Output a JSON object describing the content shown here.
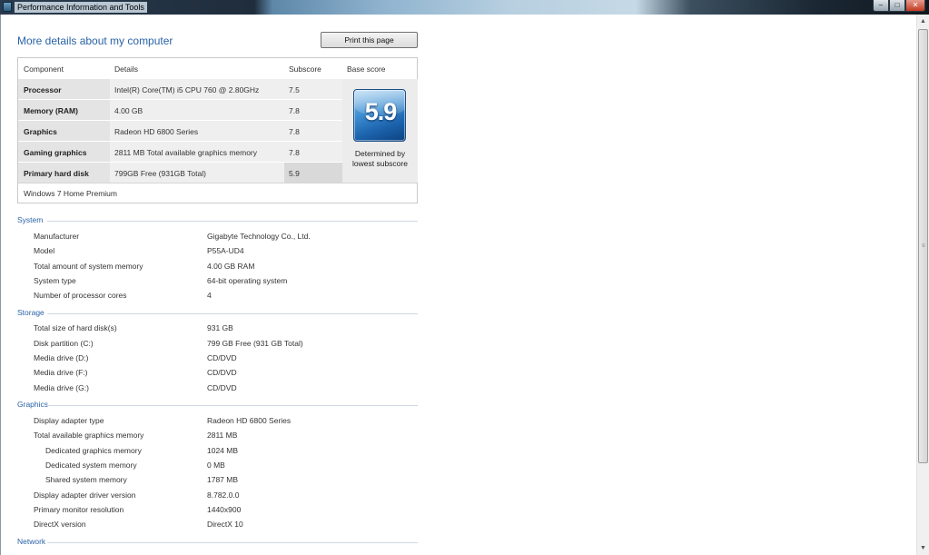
{
  "window": {
    "title": "Performance Information and Tools",
    "buttons": {
      "minimize": "–",
      "maximize": "□",
      "close": "✕"
    }
  },
  "page": {
    "title": "More details about my computer",
    "print_label": "Print this page"
  },
  "score_table": {
    "headers": [
      "Component",
      "Details",
      "Subscore",
      "Base score"
    ],
    "rows": [
      {
        "component": "Processor",
        "details": "Intel(R) Core(TM) i5 CPU 760 @ 2.80GHz",
        "subscore": "7.5"
      },
      {
        "component": "Memory (RAM)",
        "details": "4.00 GB",
        "subscore": "7.8"
      },
      {
        "component": "Graphics",
        "details": "Radeon HD 6800 Series",
        "subscore": "7.8"
      },
      {
        "component": "Gaming graphics",
        "details": "2811 MB Total available graphics memory",
        "subscore": "7.8"
      },
      {
        "component": "Primary hard disk",
        "details": "799GB Free (931GB Total)",
        "subscore": "5.9"
      }
    ],
    "base_score": "5.9",
    "base_caption_1": "Determined by",
    "base_caption_2": "lowest subscore",
    "edition": "Windows 7 Home Premium"
  },
  "sections": {
    "system": {
      "title": "System",
      "items": [
        {
          "k": "Manufacturer",
          "v": "Gigabyte Technology Co., Ltd."
        },
        {
          "k": "Model",
          "v": "P55A-UD4"
        },
        {
          "k": "Total amount of system memory",
          "v": "4.00 GB RAM"
        },
        {
          "k": "System type",
          "v": "64-bit operating system"
        },
        {
          "k": "Number of processor cores",
          "v": "4"
        }
      ]
    },
    "storage": {
      "title": "Storage",
      "items": [
        {
          "k": "Total size of hard disk(s)",
          "v": "931 GB"
        },
        {
          "k": "Disk partition (C:)",
          "v": "799 GB Free (931 GB Total)"
        },
        {
          "k": "Media drive (D:)",
          "v": "CD/DVD"
        },
        {
          "k": "Media drive (F:)",
          "v": "CD/DVD"
        },
        {
          "k": "Media drive (G:)",
          "v": "CD/DVD"
        }
      ]
    },
    "graphics": {
      "title": "Graphics",
      "items": [
        {
          "k": "Display adapter type",
          "v": "Radeon HD 6800 Series"
        },
        {
          "k": "Total available graphics memory",
          "v": "2811 MB"
        },
        {
          "k": "Dedicated graphics memory",
          "v": "1024 MB"
        },
        {
          "k": "Dedicated system memory",
          "v": "0 MB"
        },
        {
          "k": "Shared system memory",
          "v": "1787 MB"
        },
        {
          "k": "Display adapter driver version",
          "v": "8.782.0.0"
        },
        {
          "k": "Primary monitor resolution",
          "v": "1440x900"
        },
        {
          "k": "DirectX version",
          "v": "DirectX 10"
        }
      ]
    },
    "network": {
      "title": "Network"
    }
  },
  "scrollbar": {
    "up": "▲",
    "down": "▼",
    "grip": "≡"
  }
}
